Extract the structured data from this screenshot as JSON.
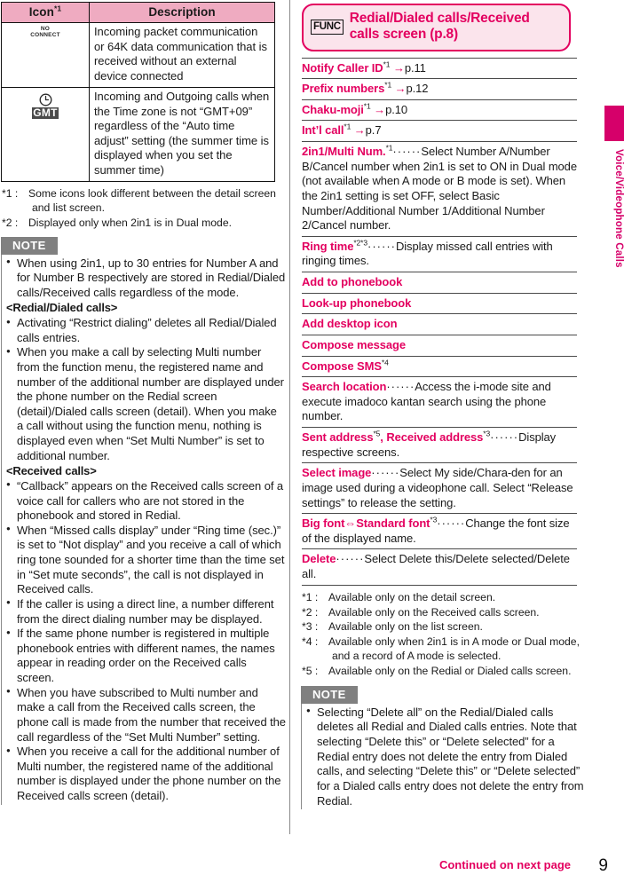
{
  "table": {
    "headers": [
      "Icon",
      "Description"
    ],
    "header_footnote": "*1",
    "rows": [
      {
        "icon_name": "no-connect-icon",
        "icon_text": "NO CONNECT",
        "description": "Incoming packet communication or 64K data communication that is received without an external device connected"
      },
      {
        "icon_name": "gmt-clock-icon",
        "icon_text": "GMT",
        "description": "Incoming and Outgoing calls when the Time zone is not “GMT+09” regardless of the “Auto time adjust” setting (the summer time is displayed when you set the summer time)"
      }
    ]
  },
  "left_footnotes": [
    {
      "label": "*1 :",
      "text": "Some icons look different between the detail screen and list screen."
    },
    {
      "label": "*2 :",
      "text": "Displayed only when 2in1 is in Dual mode."
    }
  ],
  "left_note": {
    "badge": "NOTE",
    "items": [
      {
        "type": "bullet",
        "text": "When using 2in1, up to 30 entries for Number A and for Number B respectively are stored in Redial/Dialed calls/Received calls regardless of the mode."
      },
      {
        "type": "head",
        "text": "<Redial/Dialed calls>"
      },
      {
        "type": "bullet",
        "text": "Activating “Restrict dialing” deletes all Redial/Dialed calls entries."
      },
      {
        "type": "bullet",
        "text": "When you make a call by selecting Multi number from the function menu, the registered name and number of the additional number are displayed under the phone number on the Redial screen (detail)/Dialed calls screen (detail). When you make a call without using the function menu, nothing is displayed even when “Set Multi Number” is set to additional number."
      },
      {
        "type": "head",
        "text": "<Received calls>"
      },
      {
        "type": "bullet",
        "text": "“Callback” appears on the Received calls screen of a voice call for callers who are not stored in the phonebook and stored in Redial."
      },
      {
        "type": "bullet",
        "text": "When “Missed calls display” under “Ring time (sec.)” is set to “Not display” and you receive a call of which ring tone sounded for a shorter time than the time set in “Set mute seconds”, the call is not displayed in Received calls."
      },
      {
        "type": "bullet",
        "text": "If the caller is using a direct line, a number different from the direct dialing number may be displayed."
      },
      {
        "type": "bullet",
        "text": "If the same phone number is registered in multiple phonebook entries with different names, the names appear in reading order on the Received calls screen."
      },
      {
        "type": "bullet",
        "text": "When you have subscribed to Multi number and make a call from the Received calls screen, the phone call is made from the number that received the call regardless of the “Set Multi Number” setting."
      },
      {
        "type": "bullet",
        "text": "When you receive a call for the additional number of Multi number, the registered name of the additional number is displayed under the phone number on the Received calls screen (detail)."
      }
    ]
  },
  "func_header": {
    "key_label": "FUNC",
    "title": "Redial/Dialed calls/Received calls screen (p.8)"
  },
  "menu_items": [
    {
      "label": "Notify Caller ID",
      "sup": "*1",
      "arrow": "→",
      "link": "p.11",
      "dots": "",
      "text": ""
    },
    {
      "label": "Prefix numbers",
      "sup": "*1",
      "arrow": "→",
      "link": "p.12",
      "dots": "",
      "text": ""
    },
    {
      "label": "Chaku-moji",
      "sup": "*1",
      "arrow": "→",
      "link": "p.10",
      "dots": "",
      "text": ""
    },
    {
      "label": "Int’l call",
      "sup": "*1",
      "arrow": "→",
      "link": "p.7",
      "dots": "",
      "text": ""
    },
    {
      "label": "2in1/Multi Num.",
      "sup": "*1",
      "arrow": "",
      "link": "",
      "dots": "······",
      "text": "Select Number A/Number B/Cancel number when 2in1 is set to ON in Dual mode (not available when A mode or B mode is set). When the 2in1 setting is set OFF, select Basic Number/Additional Number 1/Additional Number 2/Cancel number."
    },
    {
      "label": "Ring time",
      "sup": "*2*3",
      "arrow": "",
      "link": "",
      "dots": "······",
      "text": "Display missed call entries with ringing times."
    },
    {
      "label": "Add to phonebook",
      "sup": "",
      "arrow": "",
      "link": "",
      "dots": "",
      "text": ""
    },
    {
      "label": "Look-up phonebook",
      "sup": "",
      "arrow": "",
      "link": "",
      "dots": "",
      "text": ""
    },
    {
      "label": "Add desktop icon",
      "sup": "",
      "arrow": "",
      "link": "",
      "dots": "",
      "text": ""
    },
    {
      "label": "Compose message",
      "sup": "",
      "arrow": "",
      "link": "",
      "dots": "",
      "text": ""
    },
    {
      "label": "Compose SMS",
      "sup": "*4",
      "arrow": "",
      "link": "",
      "dots": "",
      "text": ""
    },
    {
      "label": "Search location",
      "sup": "",
      "arrow": "",
      "link": "",
      "dots": "······",
      "text": "Access the i-mode site and execute imadoco kantan search using the phone number."
    },
    {
      "label": "Sent address",
      "sup": "*5",
      "label2": ", ",
      "label3": "Received address",
      "sup3": "*3",
      "arrow": "",
      "link": "",
      "dots": "······",
      "text": "Display respective screens."
    },
    {
      "label": "Select image",
      "sup": "",
      "arrow": "",
      "link": "",
      "dots": "······",
      "text": "Select My side/Chara-den for an image used during a videophone call. Select “Release settings” to release the setting."
    },
    {
      "label": "Big font",
      "sup": "",
      "label2": "⇔",
      "label3": "Standard font",
      "sup3": "*3",
      "arrow": "",
      "link": "",
      "dots": "······",
      "text": "Change the font size of the displayed name."
    },
    {
      "label": "Delete",
      "sup": "",
      "arrow": "",
      "link": "",
      "dots": "······",
      "text": "Select Delete this/Delete selected/Delete all."
    }
  ],
  "right_footnotes": [
    {
      "label": "*1 :",
      "text": "Available only on the detail screen."
    },
    {
      "label": "*2 :",
      "text": "Available only on the Received calls screen."
    },
    {
      "label": "*3 :",
      "text": "Available only on the list screen."
    },
    {
      "label": "*4 :",
      "text": "Available only when 2in1 is in A mode or Dual mode, and a record of A mode is selected."
    },
    {
      "label": "*5 :",
      "text": "Available only on the Redial or Dialed calls screen."
    }
  ],
  "right_note": {
    "badge": "NOTE",
    "items": [
      {
        "type": "bullet",
        "text": "Selecting “Delete all” on the Redial/Dialed calls deletes all Redial and Dialed calls entries. Note that selecting “Delete this” or “Delete selected” for a Redial entry does not delete the entry from Dialed calls, and selecting “Delete this” or “Delete selected” for a Dialed calls entry does not delete the entry from Redial."
      }
    ]
  },
  "side_tab": {
    "label": "Voice/Videophone Calls"
  },
  "footer": {
    "continued": "Continued on next page",
    "page_number": "9"
  },
  "colors": {
    "accent_pink": "#e3005f",
    "tab_pink": "#d6006a",
    "table_header_pink": "#efabc1",
    "func_bg": "#fbe4ec",
    "note_gray": "#808080"
  }
}
